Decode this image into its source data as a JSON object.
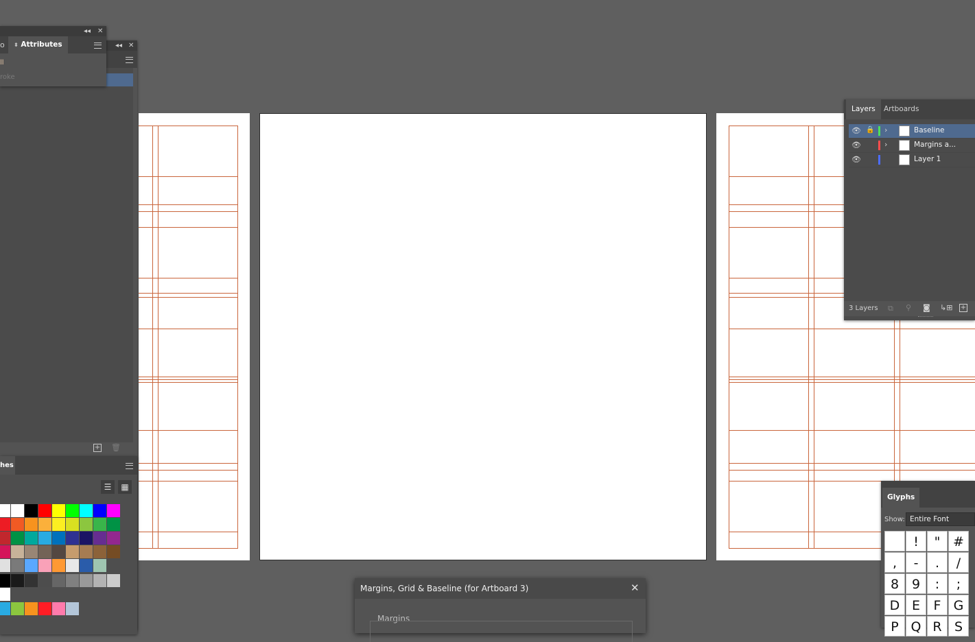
{
  "attributes_panel": {
    "tab_label": "Attributes",
    "row1": "ll",
    "row2": "roke"
  },
  "left_panel": {
    "buttons": [
      "new-item",
      "delete"
    ]
  },
  "swatches_panel": {
    "tab_partial": "hes",
    "view_modes": [
      "list-view",
      "grid-view"
    ],
    "colors": [
      [
        "#ffffff",
        "#ffffff",
        "#000000",
        "#ff0000",
        "#ffff00",
        "#00ff00",
        "#00ffff",
        "#0000ff",
        "#ff00ff"
      ],
      [
        "#ed1c24",
        "#f15a24",
        "#f7931e",
        "#fbb03b",
        "#fcee21",
        "#d9e021",
        "#8cc63f",
        "#39b54a",
        "#009245"
      ],
      [
        "#c1272d",
        "#009245",
        "#00a99d",
        "#29abe2",
        "#0071bc",
        "#2e3192",
        "#1b1464",
        "#662d91",
        "#93278f"
      ],
      [
        "#d4145a",
        "#c7b299",
        "#998675",
        "#736357",
        "#534741",
        "#c69c6d",
        "#a67c52",
        "#8c6239",
        "#754c24"
      ],
      [
        "#e0e0e0",
        "#7a7a7a",
        "#5aa8ff",
        "#f9a1b8",
        "#ff9933",
        "#e8e8e8",
        "#2a5caa",
        "#9fc5b0"
      ],
      [
        "#000000",
        "#1a1a1a",
        "#333333",
        "#4d4d4d",
        "#666666",
        "#808080",
        "#999999",
        "#b3b3b3",
        "#cccccc"
      ],
      [
        "#ffffff"
      ],
      [
        "#29abe2",
        "#8cc63f",
        "#f7931e",
        "#ff1d25",
        "#ff7bac",
        "#b3c6d9"
      ]
    ]
  },
  "layers_panel": {
    "tabs": [
      "Layers",
      "Artboards"
    ],
    "layers": [
      {
        "name": "Baseline",
        "color": "#4ee05a",
        "selected": true,
        "locked": true,
        "expandable": true
      },
      {
        "name": "Margins a...",
        "color": "#ff4d4d",
        "selected": false,
        "locked": false,
        "expandable": true
      },
      {
        "name": "Layer 1",
        "color": "#4d6dff",
        "selected": false,
        "locked": false,
        "expandable": false
      }
    ],
    "count_label": "3 Layers"
  },
  "glyphs_panel": {
    "tab_label": "Glyphs",
    "show_label": "Show:",
    "show_value": "Entire Font",
    "rows": [
      [
        "",
        "!",
        "\"",
        "#"
      ],
      [
        ",",
        "-",
        ".",
        "/"
      ],
      [
        "8",
        "9",
        ":",
        ";"
      ],
      [
        "D",
        "E",
        "F",
        "G"
      ],
      [
        "P",
        "Q",
        "R",
        "S"
      ]
    ]
  },
  "dialog": {
    "title": "Margins, Grid & Baseline (for Artboard 3)",
    "section": "Margins"
  }
}
